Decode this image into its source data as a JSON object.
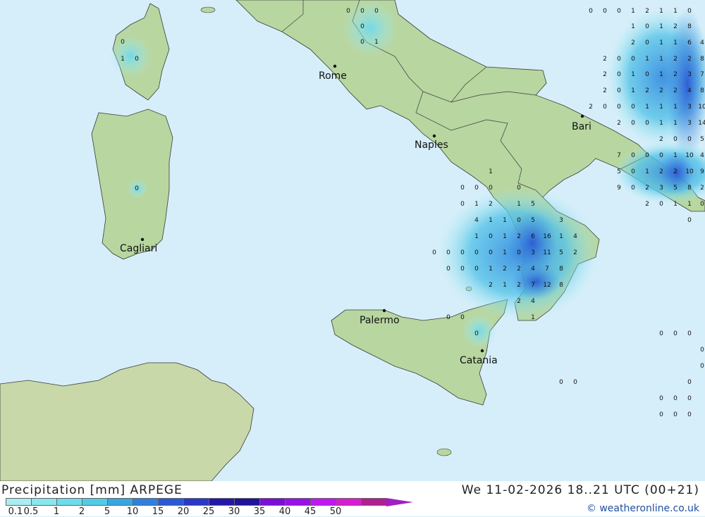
{
  "header": {
    "title": "Precipitation [mm] ARPEGE",
    "datetime": "We 11-02-2026 18..21 UTC (00+21)",
    "credit": "© weatheronline.co.uk"
  },
  "legend": {
    "colors": [
      "#a8eef2",
      "#8ae6ee",
      "#6edcea",
      "#52cce6",
      "#3aa6e0",
      "#3080dc",
      "#2c5ad4",
      "#2a38c8",
      "#2418a8",
      "#20129a",
      "#7a10d8",
      "#9a10e8",
      "#c018f0",
      "#d81cd0",
      "#b02090"
    ],
    "labels": [
      "0.1",
      "0.5",
      "1",
      "2",
      "5",
      "10",
      "15",
      "20",
      "25",
      "30",
      "35",
      "40",
      "45",
      "50"
    ]
  },
  "cities": [
    {
      "name": "Rome"
    },
    {
      "name": "Naples"
    },
    {
      "name": "Bari"
    },
    {
      "name": "Cagliari"
    },
    {
      "name": "Palermo"
    },
    {
      "name": "Catania"
    }
  ],
  "grid_values": [
    "0",
    "0",
    "0",
    "0",
    "1",
    "0",
    "0",
    "1",
    "0",
    "0",
    "0",
    "0",
    "0",
    "1",
    "2",
    "1",
    "1",
    "0",
    "1",
    "0",
    "1",
    "2",
    "8",
    "2",
    "0",
    "1",
    "1",
    "6",
    "4",
    "2",
    "0",
    "0",
    "1",
    "1",
    "2",
    "2",
    "8",
    "2",
    "0",
    "1",
    "0",
    "1",
    "2",
    "3",
    "7",
    "2",
    "0",
    "1",
    "2",
    "2",
    "2",
    "4",
    "8",
    "2",
    "0",
    "0",
    "0",
    "1",
    "1",
    "1",
    "3",
    "10",
    "2",
    "0",
    "0",
    "1",
    "1",
    "3",
    "14",
    "2",
    "0",
    "0",
    "5",
    "7",
    "0",
    "0",
    "0",
    "1",
    "10",
    "4",
    "5",
    "0",
    "1",
    "2",
    "2",
    "10",
    "9",
    "9",
    "0",
    "2",
    "3",
    "5",
    "8",
    "2",
    "2",
    "0",
    "1",
    "1",
    "0",
    "0",
    "0",
    "0",
    "0",
    "0",
    "0",
    "1",
    "2",
    "1",
    "5",
    "4",
    "1",
    "1",
    "0",
    "5",
    "3",
    "1",
    "0",
    "1",
    "2",
    "6",
    "16",
    "1",
    "4",
    "0",
    "0",
    "0",
    "0",
    "0",
    "1",
    "0",
    "3",
    "11",
    "5",
    "2",
    "0",
    "0",
    "0",
    "1",
    "2",
    "2",
    "4",
    "7",
    "8",
    "2",
    "1",
    "2",
    "7",
    "12",
    "8",
    "2",
    "4",
    "1",
    "0",
    "0",
    "0",
    "1",
    "0",
    "0",
    "0",
    "0",
    "0",
    "0",
    "0",
    "0",
    "0",
    "0",
    "0",
    "0",
    "0",
    "0",
    "0"
  ]
}
